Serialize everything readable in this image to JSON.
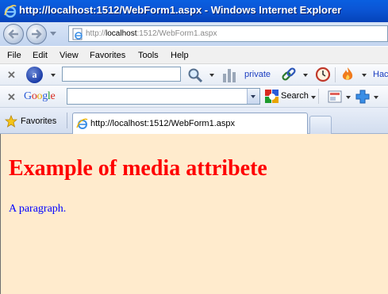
{
  "window": {
    "title": "http://localhost:1512/WebForm1.aspx - Windows Internet Explorer"
  },
  "address_bar": {
    "url_prefix": "http://",
    "url_host": "localhost",
    "url_suffix": ":1512/WebForm1.aspx"
  },
  "menu": {
    "items": [
      "File",
      "Edit",
      "View",
      "Favorites",
      "Tools",
      "Help"
    ]
  },
  "ask_toolbar": {
    "search_value": "",
    "private_label": "private",
    "trailing_label": "Hac"
  },
  "google_toolbar": {
    "logo_letters": [
      "G",
      "o",
      "o",
      "g",
      "l",
      "e"
    ],
    "logo_colors": [
      "#2a5bd7",
      "#d82a20",
      "#e8a400",
      "#2a5bd7",
      "#1e9b2e",
      "#d82a20"
    ],
    "search_value": "",
    "search_label": "Search"
  },
  "favorites_bar": {
    "favorites_label": "Favorites",
    "tab_label": "http://localhost:1512/WebForm1.aspx"
  },
  "page": {
    "background": "#ffebcd",
    "heading": "Example of media attribete",
    "heading_color": "#ff0000",
    "paragraph": "A paragraph.",
    "paragraph_color": "#0000ff"
  },
  "icons": {
    "title": "ie-icon",
    "back": "back-arrow-icon",
    "forward": "forward-arrow-icon",
    "page": "page-icon",
    "search": "magnifier-icon",
    "stats": "bar-chart-icon",
    "link": "chain-link-icon",
    "history": "clock-icon",
    "flame": "flame-icon",
    "star": "star-icon"
  }
}
